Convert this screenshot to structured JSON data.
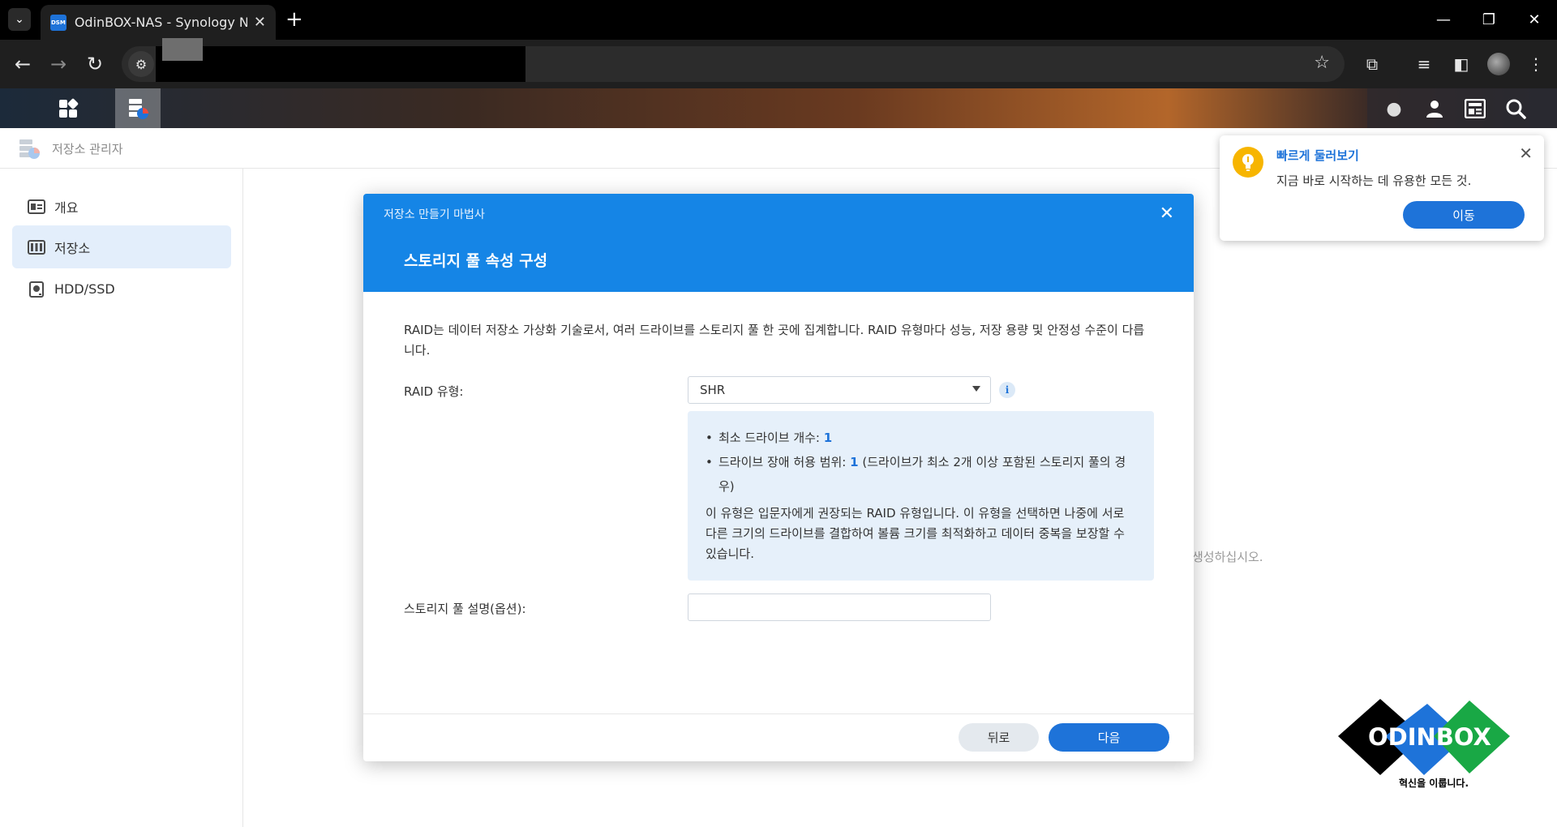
{
  "browser": {
    "tab_title": "OdinBOX-NAS - Synology NAS",
    "favicon_text": "DSM",
    "new_tab": "+",
    "window_controls": {
      "minimize": "—",
      "restore": "❐",
      "close": "✕"
    }
  },
  "app": {
    "title": "저장소 관리자",
    "sidebar": [
      {
        "label": "개요",
        "icon": "overview-card-icon"
      },
      {
        "label": "저장소",
        "icon": "storage-columns-icon",
        "active": true
      },
      {
        "label": "HDD/SSD",
        "icon": "disk-icon"
      }
    ],
    "background_hint": "생성하십시오."
  },
  "wizard": {
    "window_title": "저장소 만들기 마법사",
    "step_title": "스토리지 풀 속성 구성",
    "description": "RAID는 데이터 저장소 가상화 기술로서, 여러 드라이브를 스토리지 풀 한 곳에 집계합니다. RAID 유형마다 성능, 저장 용량 및 안정성 수준이 다릅니다.",
    "raid_label": "RAID 유형:",
    "raid_value": "SHR",
    "info_icon": "i",
    "min_drives_label": "최소 드라이브 개수:",
    "min_drives_value": "1",
    "fault_tolerance_label": "드라이브 장애 허용 범위:",
    "fault_tolerance_value": "1",
    "fault_tolerance_note": "(드라이브가 최소 2개 이상 포함된 스토리지 풀의 경우)",
    "raid_description": "이 유형은 입문자에게 권장되는 RAID 유형입니다. 이 유형을 선택하면 나중에 서로 다른 크기의 드라이브를 결합하여 볼륨 크기를 최적화하고 데이터 중복을 보장할 수 있습니다.",
    "pool_desc_label": "스토리지 풀 설명(옵션):",
    "pool_desc_value": "",
    "back_button": "뒤로",
    "next_button": "다음"
  },
  "toast": {
    "title": "빠르게 둘러보기",
    "message": "지금 바로 시작하는 데 유용한 모든 것.",
    "button": "이동"
  },
  "watermark": {
    "logo_text": "ODINBOX",
    "tagline": "혁신을 이룹니다."
  },
  "colors": {
    "accent": "#1e73d9",
    "dialog_header": "#1585e6",
    "sidebar_active": "#e3eefb",
    "info_box": "#e6f0fa",
    "toast_bulb": "#f7b500"
  }
}
